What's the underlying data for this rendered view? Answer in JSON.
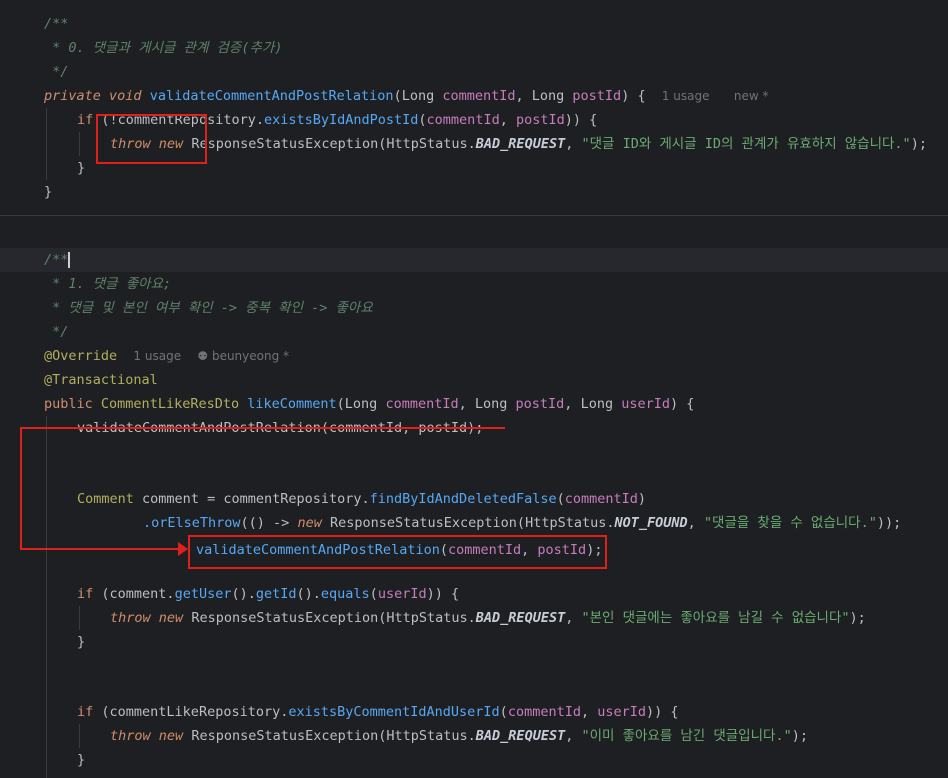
{
  "m1": {
    "doc_open": "/**",
    "doc_text": " * 0. 댓글과 게시글 관계 검증(추가)",
    "doc_close": " */",
    "sig": {
      "kw_private": "private",
      "kw_void": "void",
      "name": "validateCommentAndPostRelation",
      "p1_type": "Long",
      "p1": "commentId",
      "p2_type": "Long",
      "p2": "postId",
      "hint_usage": "1 usage",
      "hint_new": "new *"
    },
    "if_line": {
      "kw_if": "if",
      "prefix": "(!commentRepository.",
      "call": "existsByIdAndPostId",
      "a1": "commentId",
      "a2": "postId",
      "suffix": ")) {"
    },
    "throw_line": {
      "kw_throw": "throw",
      "kw_new": "new",
      "exc": "ResponseStatusException",
      "enum": "HttpStatus.",
      "const": "BAD_REQUEST",
      "msg": "\"댓글 ID와 게시글 ID의 관계가 유효하지 않습니다.\""
    },
    "brace_inner": "}",
    "brace_outer": "}"
  },
  "m2": {
    "doc_open": "/**",
    "doc_text1": " * 1. 댓글 좋아요;",
    "doc_text2": " * 댓글 및 본인 여부 확인 -> 중복 확인 -> 좋아요",
    "doc_close": " */",
    "ann_override": "@Override",
    "hint_usage": "1 usage",
    "hint_author": "beunyeong *",
    "ann_transactional": "@Transactional",
    "sig": {
      "kw_public": "public",
      "ret": "CommentLikeResDto",
      "name": "likeComment",
      "p1_type": "Long",
      "p1": "commentId",
      "p2_type": "Long",
      "p2": "postId",
      "p3_type": "Long",
      "p3": "userId"
    },
    "struck_call": "validateCommentAndPostRelation(commentId, postId);",
    "comment_line": {
      "type": "Comment",
      "var": "comment",
      "repo": "commentRepository.",
      "call": "findByIdAndDeletedFalse",
      "arg": "commentId"
    },
    "or_else": {
      "call": ".orElseThrow",
      "arrow": "(() -> ",
      "kw_new": "new",
      "exc": "ResponseStatusException",
      "enum": "HttpStatus.",
      "const": "NOT_FOUND",
      "msg": "\"댓글을 찾을 수 없습니다.\""
    },
    "moved_call": {
      "name": "validateCommentAndPostRelation",
      "a1": "commentId",
      "a2": "postId"
    },
    "if_user": {
      "kw_if": "if",
      "text1": "(comment.",
      "getUser": "getUser",
      "text2": "().",
      "getId": "getId",
      "text3": "().",
      "equals": "equals",
      "arg": "userId"
    },
    "throw_user": {
      "kw_throw": "throw",
      "kw_new": "new",
      "exc": "ResponseStatusException",
      "enum": "HttpStatus.",
      "const": "BAD_REQUEST",
      "msg": "\"본인 댓글에는 좋아요를 남길 수 없습니다\""
    },
    "if_dup": {
      "kw_if": "if",
      "repo": "(commentLikeRepository.",
      "call": "existsByCommentIdAndUserId",
      "a1": "commentId",
      "a2": "userId"
    },
    "throw_dup": {
      "kw_throw": "throw",
      "kw_new": "new",
      "exc": "ResponseStatusException",
      "enum": "HttpStatus.",
      "const": "BAD_REQUEST",
      "msg": "\"이미 좋아요를 남긴 댓글입니다.\""
    },
    "brace": "}"
  }
}
